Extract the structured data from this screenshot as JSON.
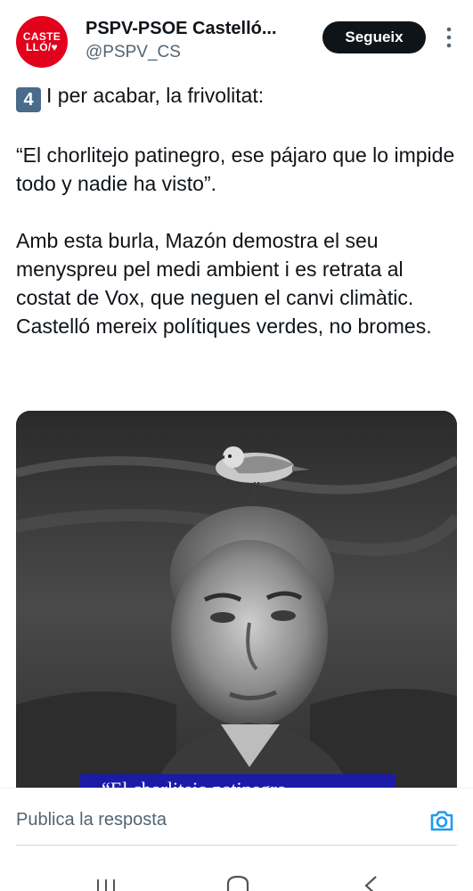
{
  "account": {
    "avatar_line1": "CASTE",
    "avatar_line2": "LLÓ/♥",
    "name": "PSPV-PSOE Castelló...",
    "handle": "@PSPV_CS",
    "follow_label": "Segueix"
  },
  "tweet": {
    "keycap": "4",
    "line1": "I per acabar, la frivolitat:",
    "quote": "“El chorlitejo patinegro, ese pájaro que lo impide todo y nadie ha visto”.",
    "body": "Amb esta burla, Mazón demostra el seu menyspreu pel medi ambient i es retrata al costat de Vox, que neguen el canvi climàtic. Castelló mereix polítiques verdes, no bromes."
  },
  "media": {
    "caption_fragment": "“El chorlitejo patinegro"
  },
  "reply": {
    "placeholder": "Publica la resposta"
  },
  "colors": {
    "brand_red": "#e3001b",
    "text": "#0f1419",
    "muted": "#536471",
    "accent_blue": "#1d9bf0",
    "caption_bg": "#1c1ba8"
  },
  "icons": {
    "more": "more-vertical-icon",
    "camera": "camera-icon",
    "recents": "recents-icon",
    "home": "home-icon",
    "back": "back-icon"
  }
}
